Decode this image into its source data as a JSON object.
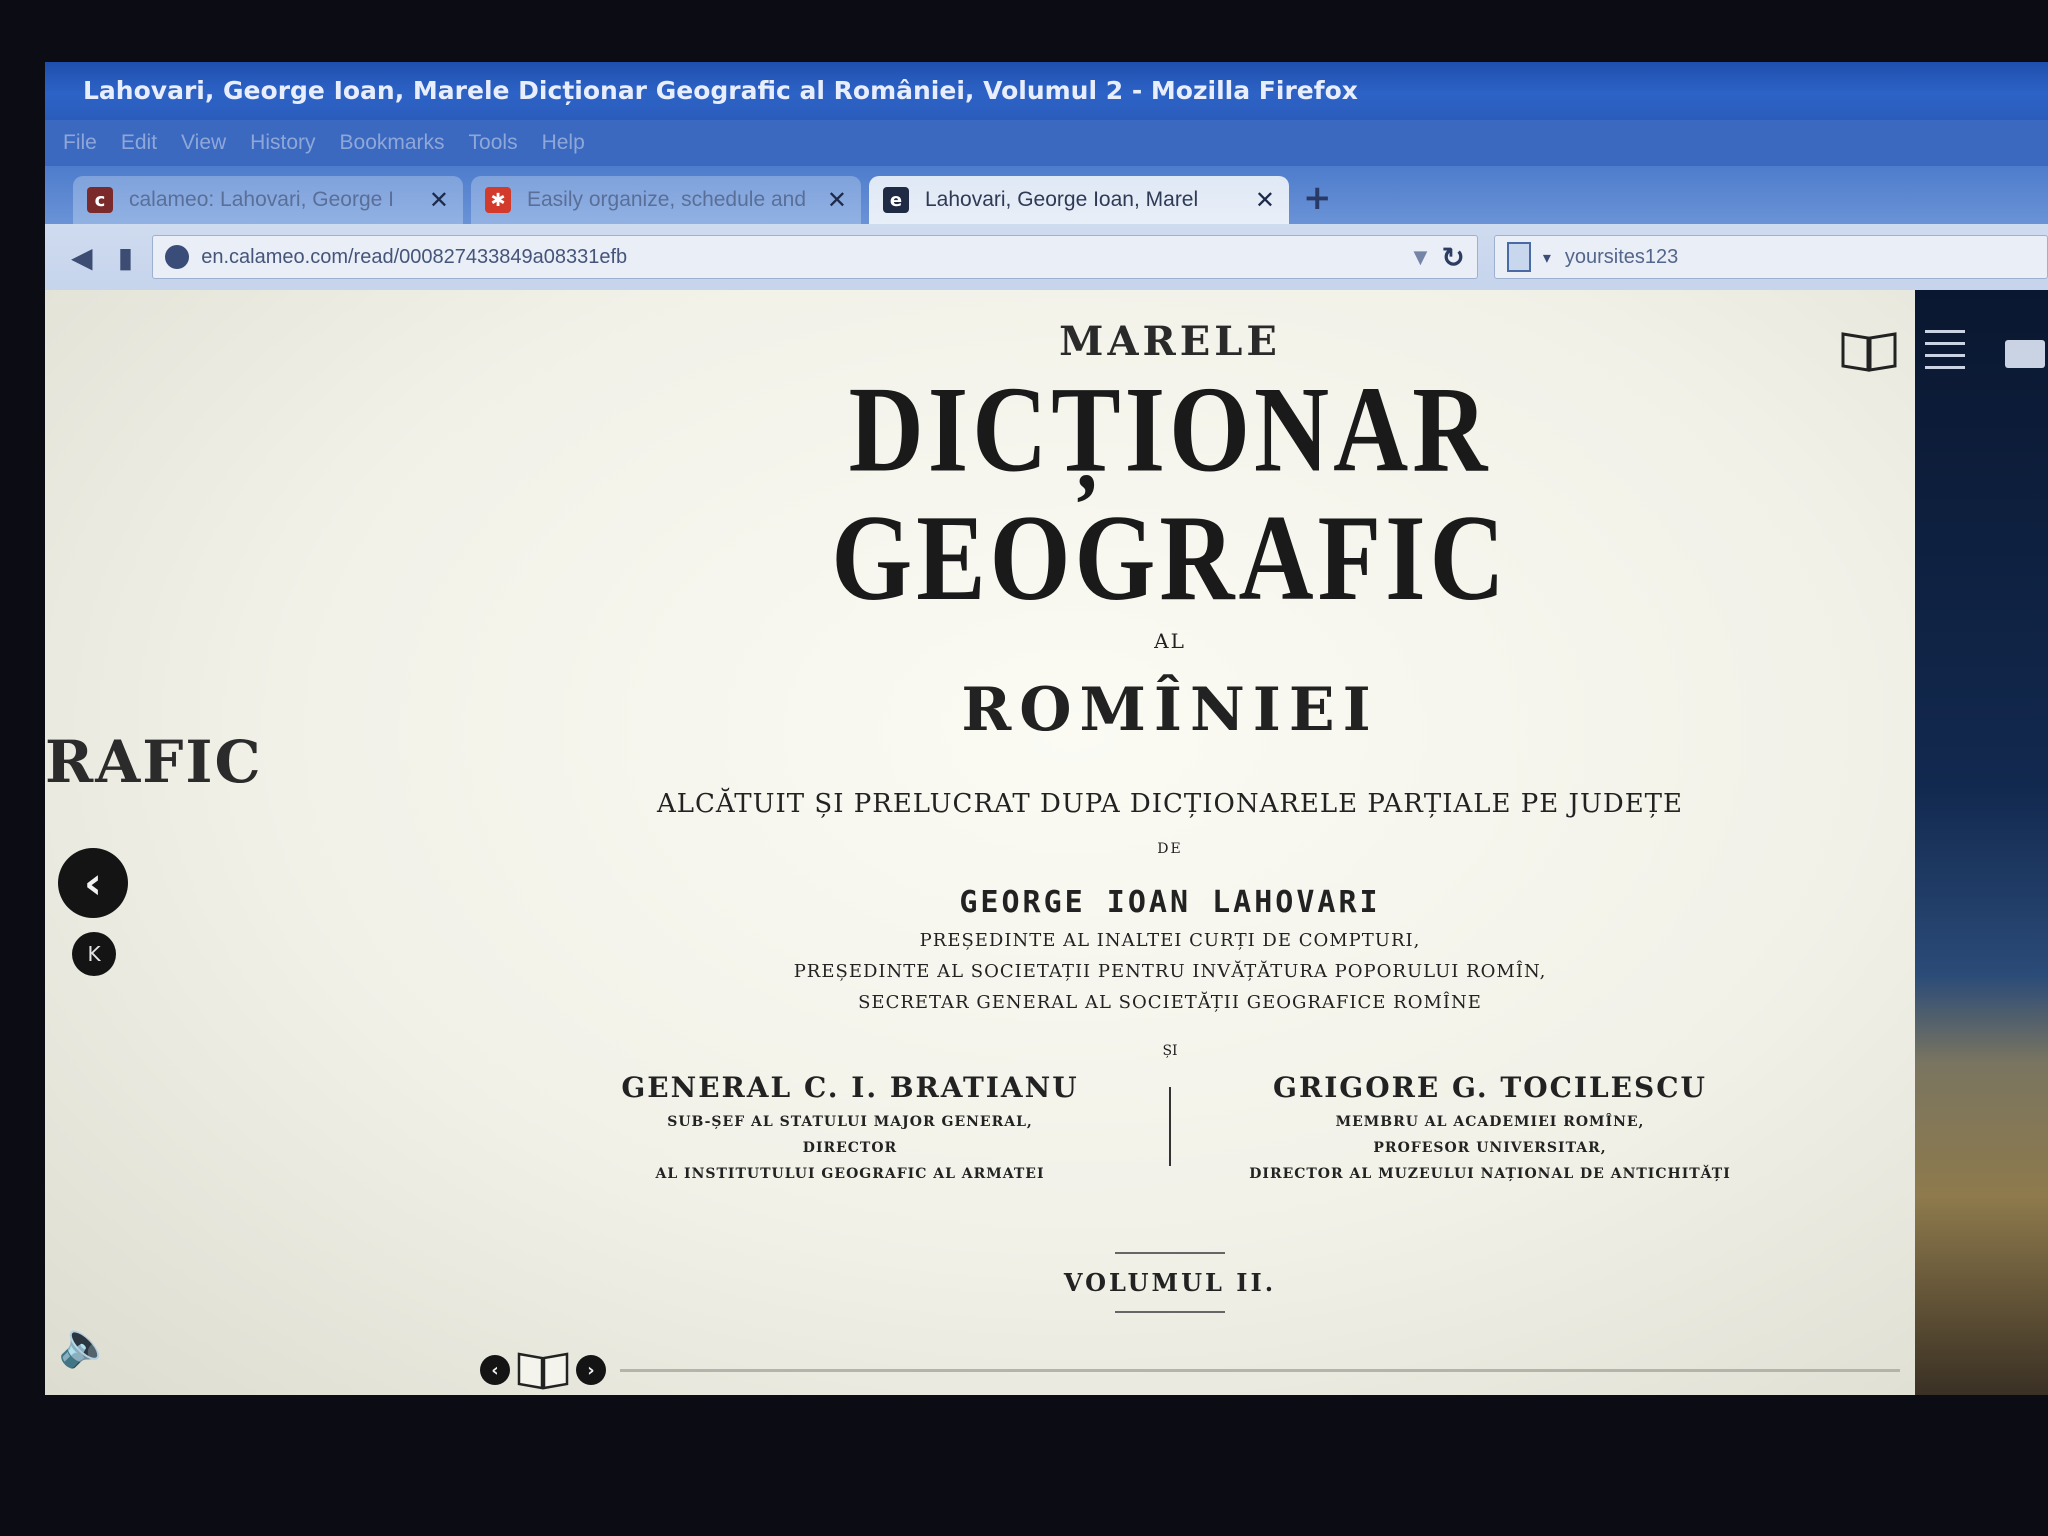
{
  "browser": {
    "window_title": "Lahovari, George Ioan, Marele Dicționar Geografic al României, Volumul 2 - Mozilla Firefox",
    "menu": [
      "File",
      "Edit",
      "View",
      "History",
      "Bookmarks",
      "Tools",
      "Help"
    ],
    "tabs": [
      {
        "label": "calameo: Lahovari, George I",
        "active": false,
        "favicon_color": "#a33c3c"
      },
      {
        "label": "Easily organize, schedule and",
        "active": false,
        "favicon_color": "#d23a2b"
      },
      {
        "label": "Lahovari, George Ioan, Marel",
        "active": true,
        "favicon_color": "#1f2b44"
      }
    ],
    "url": "en.calameo.com/read/000827433849a08331efb",
    "search_value": "yoursites123"
  },
  "viewer": {
    "prev_page_fragment": "RAFIC"
  },
  "document": {
    "marele": "MARELE",
    "title": "DICȚIONAR GEOGRAFIC",
    "al": "AL",
    "rominiei": "ROMÎNIEI",
    "subtitle": "ALCĂTUIT ȘI PRELUCRAT DUPA DICȚIONARELE PARȚIALE PE JUDEȚE",
    "de": "DE",
    "author": "GEORGE IOAN LAHOVARI",
    "author_roles": [
      "PREȘEDINTE AL INALTEI CURȚI DE COMPTURI,",
      "PREȘEDINTE AL SOCIETAȚII PENTRU INVĂȚĂTURA POPORULUI ROMÎN,",
      "SECRETAR GENERAL AL SOCIETĂȚII GEOGRAFICE ROMÎNE"
    ],
    "si": "ȘI",
    "coauthor_left": {
      "name": "GENERAL C. I. BRATIANU",
      "lines": [
        "SUB-ȘEF AL STATULUI MAJOR GENERAL,",
        "DIRECTOR",
        "AL INSTITUTULUI GEOGRAFIC AL ARMATEI"
      ]
    },
    "coauthor_right": {
      "name": "GRIGORE G. TOCILESCU",
      "lines": [
        "MEMBRU AL ACADEMIEI ROMÎNE,",
        "PROFESOR UNIVERSITAR,",
        "DIRECTOR AL MUZEULUI NAȚIONAL DE ANTICHITĂȚI"
      ]
    },
    "volume": "VOLUMUL II."
  }
}
